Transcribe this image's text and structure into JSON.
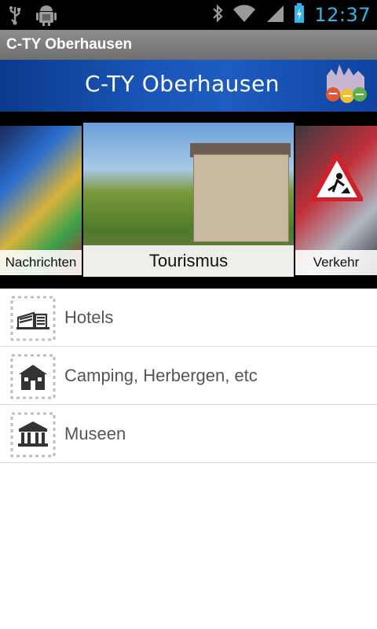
{
  "status_bar": {
    "time": "12:37",
    "icons": [
      "usb-icon",
      "android-debug-icon",
      "bluetooth-icon",
      "wifi-icon",
      "signal-icon",
      "battery-charging-icon"
    ]
  },
  "app_bar": {
    "title": "C-TY Oberhausen"
  },
  "banner": {
    "title": "C-TY Oberhausen",
    "logo_icon": "city-logo-icon"
  },
  "carousel": {
    "cards": [
      {
        "label": "Nachrichten"
      },
      {
        "label": "Tourismus"
      },
      {
        "label": "Verkehr"
      }
    ]
  },
  "list": {
    "items": [
      {
        "label": "Hotels",
        "icon": "hotel-icon"
      },
      {
        "label": "Camping, Herbergen, etc",
        "icon": "house-icon"
      },
      {
        "label": "Museen",
        "icon": "museum-icon"
      }
    ]
  },
  "colors": {
    "status_bar_bg": "#000000",
    "clock": "#33b5e5",
    "title_bar_bg": "#7a7a7a",
    "banner_bg": "#1a56b8",
    "list_text": "#555555"
  }
}
